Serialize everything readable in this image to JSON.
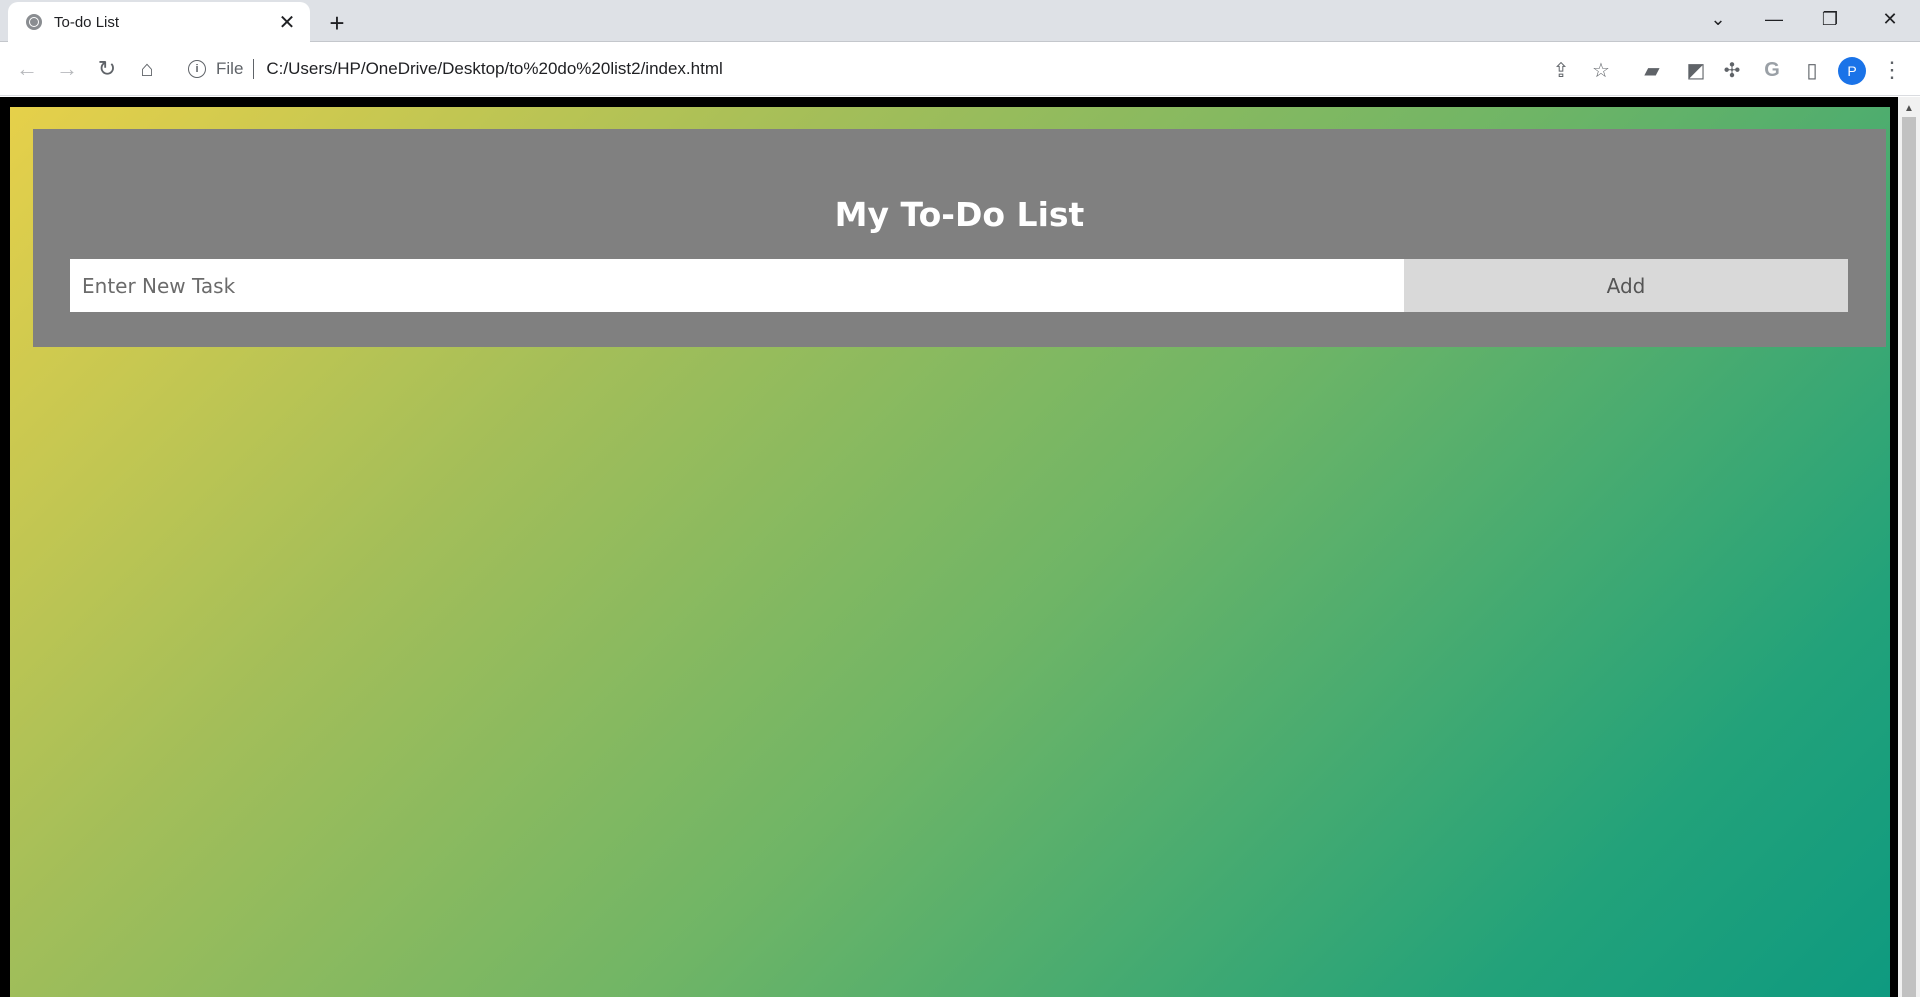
{
  "browser": {
    "tab_title": "To-do List",
    "tab_close": "✕",
    "new_tab": "+",
    "file_label": "File",
    "url": "C:/Users/HP/OneDrive/Desktop/to%20do%20list2/index.html",
    "avatar_letter": "P",
    "icons": [
      "globe-icon",
      "close-icon",
      "plus-icon",
      "chevron-down-icon",
      "minimize-icon",
      "restore-icon",
      "close-window-icon",
      "back-icon",
      "forward-icon",
      "reload-icon",
      "home-icon",
      "info-icon",
      "share-icon",
      "star-icon",
      "extension-icon",
      "puzzle-icon",
      "google-icon",
      "side-panel-icon",
      "menu-icon"
    ]
  },
  "app": {
    "title": "My To-Do List",
    "input_placeholder": "Enter New Task",
    "add_label": "Add"
  },
  "colors": {
    "card_bg": "#808080",
    "gradient_start": "#e6d04a",
    "gradient_end": "#0e9a80",
    "button_bg": "#d9d9d9"
  }
}
